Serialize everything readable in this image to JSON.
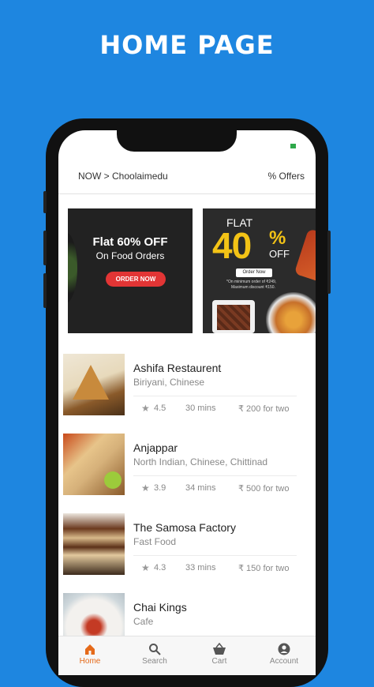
{
  "page_heading": "HOME PAGE",
  "header": {
    "location": "NOW > Choolaimedu",
    "offers": "% Offers"
  },
  "banners": {
    "first": {
      "title": "Flat 60% OFF",
      "subtitle": "On Food Orders",
      "button": "ORDER NOW"
    },
    "second": {
      "flat": "FLAT",
      "number": "40",
      "percent": "%",
      "off": "OFF",
      "button": "Order Now",
      "fine_print_1": "*On minimum order of ₹249,",
      "fine_print_2": "Maximum discount ₹150."
    }
  },
  "restaurants": [
    {
      "name": "Ashifa Restaurent",
      "cuisine": "Biriyani, Chinese",
      "rating": "4.5",
      "eta": "30 mins",
      "price": "₹ 200 for two"
    },
    {
      "name": "Anjappar",
      "cuisine": "North Indian, Chinese, Chittinad",
      "rating": "3.9",
      "eta": "34 mins",
      "price": "₹ 500 for two"
    },
    {
      "name": "The Samosa Factory",
      "cuisine": "Fast Food",
      "rating": "4.3",
      "eta": "33 mins",
      "price": "₹ 150 for two"
    },
    {
      "name": "Chai Kings",
      "cuisine": "Cafe"
    }
  ],
  "tabs": [
    {
      "label": "Home",
      "icon": "home-icon",
      "active": true
    },
    {
      "label": "Search",
      "icon": "search-icon"
    },
    {
      "label": "Cart",
      "icon": "cart-icon"
    },
    {
      "label": "Account",
      "icon": "account-icon"
    }
  ],
  "colors": {
    "background": "#1e86e0",
    "accent": "#e56a1a",
    "banner_button": "#e23535",
    "banner_highlight": "#f3c316"
  }
}
